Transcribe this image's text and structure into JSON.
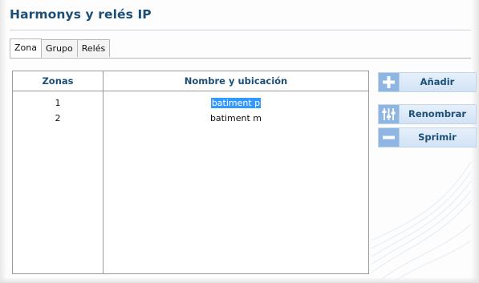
{
  "window": {
    "title": "Harmonys y relés IP"
  },
  "tabs": [
    {
      "label": "Zona",
      "active": true
    },
    {
      "label": "Grupo",
      "active": false
    },
    {
      "label": "Relés",
      "active": false
    }
  ],
  "grid": {
    "columns": [
      "Zonas",
      "Nombre y ubicación"
    ],
    "rows": [
      {
        "zona": "1",
        "nombre": "batiment p",
        "selected": true
      },
      {
        "zona": "2",
        "nombre": "batiment m",
        "selected": false
      }
    ]
  },
  "actions": {
    "add_label": "Añadir",
    "rename_label": "Renombrar",
    "delete_label": "Sprimir"
  },
  "colors": {
    "title": "#1d4f76",
    "selection": "#3399ff",
    "button_icon": "#8fb6e2"
  },
  "icons": {
    "add": "plus-icon",
    "rename": "sliders-icon",
    "delete": "minus-icon"
  }
}
